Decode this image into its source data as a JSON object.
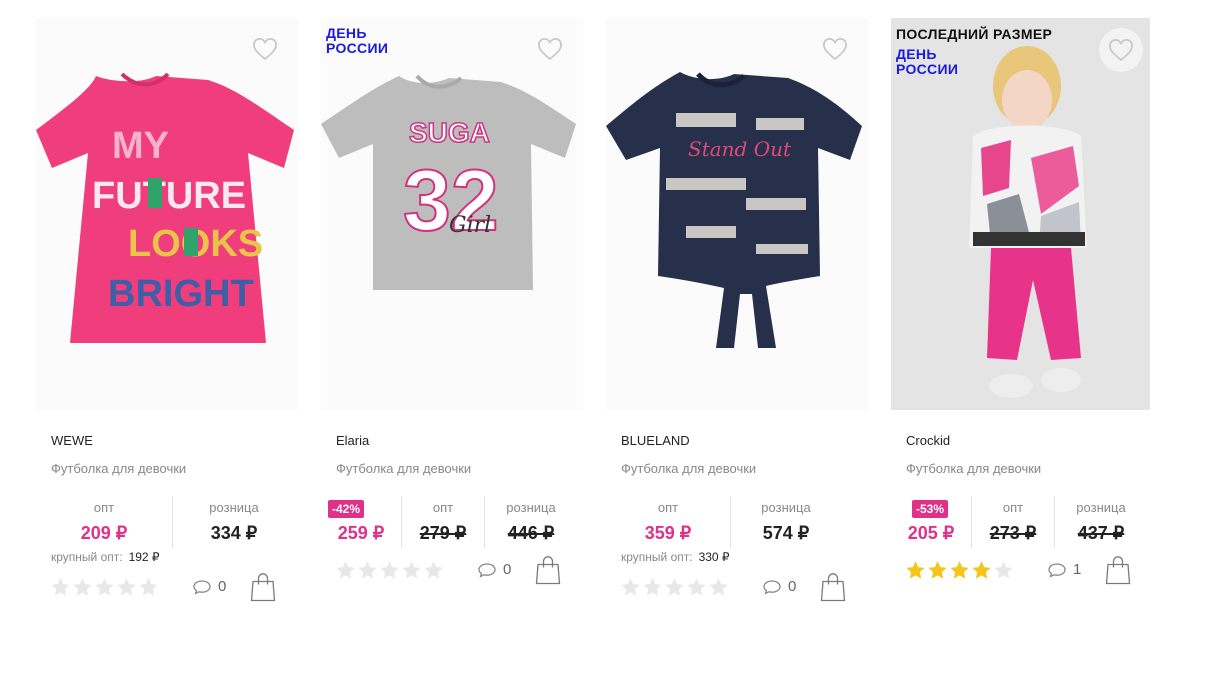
{
  "colors": {
    "accent": "#e0308a",
    "day_badge": "#1a1adb",
    "star_on": "#f5c518",
    "star_off": "#e8e8e8"
  },
  "labels": {
    "opt": "опт",
    "retail": "розница",
    "bulk_opt": "крупный опт:"
  },
  "icons": {
    "favorite": "heart-outline-icon",
    "comments": "speech-bubble-icon",
    "cart": "shopping-bag-icon",
    "rating": "star-icon"
  },
  "products": [
    {
      "brand": "WEWE",
      "name": "Футболка для девочки",
      "price_opt": "209 ₽",
      "price_retail": "334 ₽",
      "bulk_price": "192 ₽",
      "rating": 0,
      "comments": "0"
    },
    {
      "brand": "Elaria",
      "name": "Футболка для девочки",
      "badges": [
        "ДЕНЬ РОССИИ"
      ],
      "discount": "-42%",
      "price_new": "259 ₽",
      "price_opt_old": "279 ₽",
      "price_retail_old": "446 ₽",
      "rating": 0,
      "comments": "0"
    },
    {
      "brand": "BLUELAND",
      "name": "Футболка для девочки",
      "price_opt": "359 ₽",
      "price_retail": "574 ₽",
      "bulk_price": "330 ₽",
      "rating": 0,
      "comments": "0"
    },
    {
      "brand": "Crockid",
      "name": "Футболка для девочки",
      "badges": [
        "ПОСЛЕДНИЙ РАЗМЕР",
        "ДЕНЬ РОССИИ"
      ],
      "discount": "-53%",
      "price_new": "205 ₽",
      "price_opt_old": "273 ₽",
      "price_retail_old": "437 ₽",
      "rating": 4,
      "comments": "1"
    }
  ]
}
